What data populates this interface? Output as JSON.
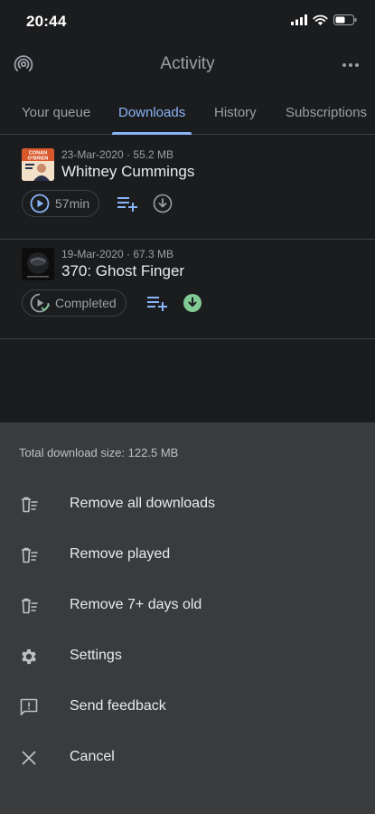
{
  "status_bar": {
    "time": "20:44"
  },
  "header": {
    "title": "Activity"
  },
  "tabs": [
    {
      "label": "Your queue"
    },
    {
      "label": "Downloads",
      "active": true
    },
    {
      "label": "History"
    },
    {
      "label": "Subscriptions"
    }
  ],
  "episodes": [
    {
      "meta": "23-Mar-2020 · 55.2 MB",
      "title": "Whitney Cummings",
      "thumb_text": "CONAN O'BRIEN",
      "play_label": "57min",
      "download_state": "downloadable"
    },
    {
      "meta": "19-Mar-2020 · 67.3 MB",
      "title": "370: Ghost Finger",
      "play_label": "Completed",
      "download_state": "downloaded"
    }
  ],
  "sheet": {
    "total_size": "Total download size: 122.5 MB",
    "items": [
      {
        "label": "Remove all downloads",
        "icon": "delete-list-icon"
      },
      {
        "label": "Remove played",
        "icon": "delete-list-icon"
      },
      {
        "label": "Remove 7+ days old",
        "icon": "delete-list-icon"
      },
      {
        "label": "Settings",
        "icon": "gear-icon"
      },
      {
        "label": "Send feedback",
        "icon": "feedback-icon"
      },
      {
        "label": "Cancel",
        "icon": "close-icon"
      }
    ]
  },
  "colors": {
    "background": "#1b1c1e",
    "sheet": "#3a3b3d",
    "accent": "#8ab4f8",
    "downloaded": "#81c995",
    "muted_text": "#9aa0a6"
  }
}
